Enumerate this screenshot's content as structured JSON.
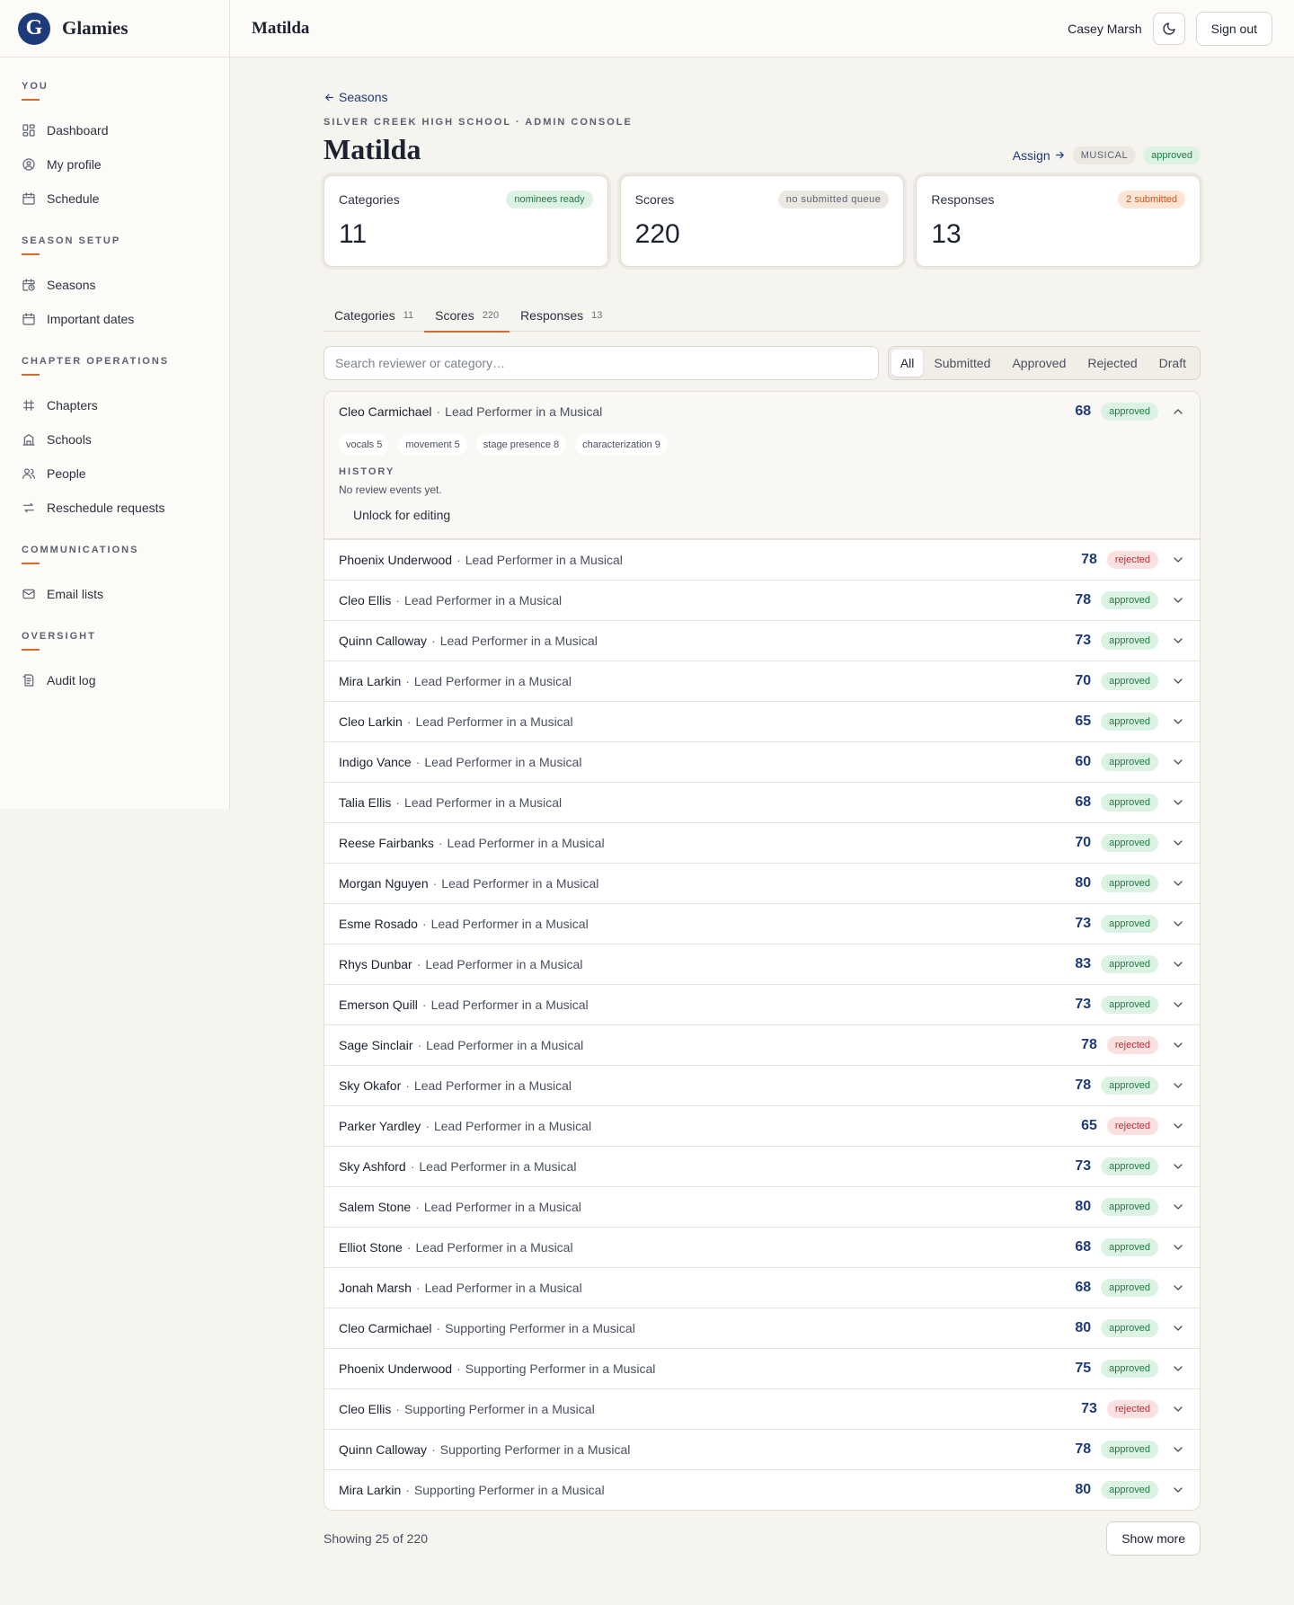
{
  "brand": {
    "name": "Glamies",
    "logo_letter": "G"
  },
  "sidebar": {
    "sections": [
      {
        "label": "You",
        "items": [
          {
            "label": "Dashboard",
            "icon": "dashboard-icon"
          },
          {
            "label": "My profile",
            "icon": "profile-icon"
          },
          {
            "label": "Schedule",
            "icon": "calendar-icon"
          }
        ]
      },
      {
        "label": "Season setup",
        "items": [
          {
            "label": "Seasons",
            "icon": "calendar-clock-icon"
          },
          {
            "label": "Important dates",
            "icon": "calendar-icon"
          }
        ]
      },
      {
        "label": "Chapter operations",
        "items": [
          {
            "label": "Chapters",
            "icon": "chapters-icon"
          },
          {
            "label": "Schools",
            "icon": "school-icon"
          },
          {
            "label": "People",
            "icon": "people-icon"
          },
          {
            "label": "Reschedule requests",
            "icon": "swap-icon"
          }
        ]
      },
      {
        "label": "Communications",
        "items": [
          {
            "label": "Email lists",
            "icon": "mail-icon"
          }
        ]
      },
      {
        "label": "Oversight",
        "items": [
          {
            "label": "Audit log",
            "icon": "audit-icon"
          }
        ]
      }
    ]
  },
  "topbar": {
    "title": "Matilda",
    "user": "Casey Marsh",
    "sign_out": "Sign out"
  },
  "page": {
    "back_label": "Seasons",
    "eyebrow": "Silver Creek High School · Admin Console",
    "title": "Matilda",
    "assign_label": "Assign",
    "type_badge": "MUSICAL",
    "status_badge": "approved"
  },
  "stats": [
    {
      "label": "Categories",
      "value": "11",
      "badge": "nominees ready",
      "tone": "green"
    },
    {
      "label": "Scores",
      "value": "220",
      "badge": "no submitted queue",
      "tone": "gray"
    },
    {
      "label": "Responses",
      "value": "13",
      "badge": "2 submitted",
      "tone": "orange"
    }
  ],
  "tabs": [
    {
      "label": "Categories",
      "count": "11",
      "active": false
    },
    {
      "label": "Scores",
      "count": "220",
      "active": true
    },
    {
      "label": "Responses",
      "count": "13",
      "active": false
    }
  ],
  "search": {
    "placeholder": "Search reviewer or category…",
    "value": ""
  },
  "filters": [
    {
      "label": "All",
      "active": true
    },
    {
      "label": "Submitted",
      "active": false
    },
    {
      "label": "Approved",
      "active": false
    },
    {
      "label": "Rejected",
      "active": false
    },
    {
      "label": "Draft",
      "active": false
    }
  ],
  "expanded": {
    "reviewer": "Cleo Carmichael",
    "category": "Lead Performer in a Musical",
    "score": "68",
    "status": "approved",
    "criteria": [
      {
        "name": "vocals",
        "value": "5"
      },
      {
        "name": "movement",
        "value": "5"
      },
      {
        "name": "stage presence",
        "value": "8"
      },
      {
        "name": "characterization",
        "value": "9"
      }
    ],
    "history_label": "History",
    "history_empty": "No review events yet.",
    "unlock_label": "Unlock for editing"
  },
  "rows": [
    {
      "reviewer": "Phoenix Underwood",
      "category": "Lead Performer in a Musical",
      "score": "78",
      "status": "rejected"
    },
    {
      "reviewer": "Cleo Ellis",
      "category": "Lead Performer in a Musical",
      "score": "78",
      "status": "approved"
    },
    {
      "reviewer": "Quinn Calloway",
      "category": "Lead Performer in a Musical",
      "score": "73",
      "status": "approved"
    },
    {
      "reviewer": "Mira Larkin",
      "category": "Lead Performer in a Musical",
      "score": "70",
      "status": "approved"
    },
    {
      "reviewer": "Cleo Larkin",
      "category": "Lead Performer in a Musical",
      "score": "65",
      "status": "approved"
    },
    {
      "reviewer": "Indigo Vance",
      "category": "Lead Performer in a Musical",
      "score": "60",
      "status": "approved"
    },
    {
      "reviewer": "Talia Ellis",
      "category": "Lead Performer in a Musical",
      "score": "68",
      "status": "approved"
    },
    {
      "reviewer": "Reese Fairbanks",
      "category": "Lead Performer in a Musical",
      "score": "70",
      "status": "approved"
    },
    {
      "reviewer": "Morgan Nguyen",
      "category": "Lead Performer in a Musical",
      "score": "80",
      "status": "approved"
    },
    {
      "reviewer": "Esme Rosado",
      "category": "Lead Performer in a Musical",
      "score": "73",
      "status": "approved"
    },
    {
      "reviewer": "Rhys Dunbar",
      "category": "Lead Performer in a Musical",
      "score": "83",
      "status": "approved"
    },
    {
      "reviewer": "Emerson Quill",
      "category": "Lead Performer in a Musical",
      "score": "73",
      "status": "approved"
    },
    {
      "reviewer": "Sage Sinclair",
      "category": "Lead Performer in a Musical",
      "score": "78",
      "status": "rejected"
    },
    {
      "reviewer": "Sky Okafor",
      "category": "Lead Performer in a Musical",
      "score": "78",
      "status": "approved"
    },
    {
      "reviewer": "Parker Yardley",
      "category": "Lead Performer in a Musical",
      "score": "65",
      "status": "rejected"
    },
    {
      "reviewer": "Sky Ashford",
      "category": "Lead Performer in a Musical",
      "score": "73",
      "status": "approved"
    },
    {
      "reviewer": "Salem Stone",
      "category": "Lead Performer in a Musical",
      "score": "80",
      "status": "approved"
    },
    {
      "reviewer": "Elliot Stone",
      "category": "Lead Performer in a Musical",
      "score": "68",
      "status": "approved"
    },
    {
      "reviewer": "Jonah Marsh",
      "category": "Lead Performer in a Musical",
      "score": "68",
      "status": "approved"
    },
    {
      "reviewer": "Cleo Carmichael",
      "category": "Supporting Performer in a Musical",
      "score": "80",
      "status": "approved"
    },
    {
      "reviewer": "Phoenix Underwood",
      "category": "Supporting Performer in a Musical",
      "score": "75",
      "status": "approved"
    },
    {
      "reviewer": "Cleo Ellis",
      "category": "Supporting Performer in a Musical",
      "score": "73",
      "status": "rejected"
    },
    {
      "reviewer": "Quinn Calloway",
      "category": "Supporting Performer in a Musical",
      "score": "78",
      "status": "approved"
    },
    {
      "reviewer": "Mira Larkin",
      "category": "Supporting Performer in a Musical",
      "score": "80",
      "status": "approved"
    }
  ],
  "footer": {
    "showing": "Showing 25 of 220",
    "show_more": "Show more"
  },
  "colors": {
    "accent": "#d76b2e",
    "brand": "#1d3a7a",
    "approved": "#1f7a44",
    "rejected": "#b3303a"
  }
}
